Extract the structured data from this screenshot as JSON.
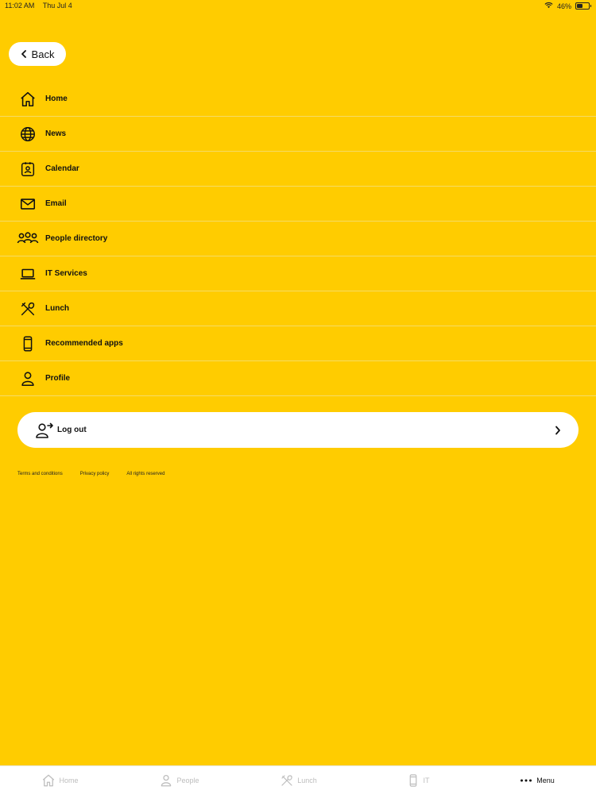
{
  "status": {
    "time": "11:02 AM",
    "date": "Thu Jul 4",
    "battery": "46%"
  },
  "back_label": "Back",
  "menu": {
    "items": [
      {
        "label": "Home",
        "icon": "home-icon"
      },
      {
        "label": "News",
        "icon": "globe-icon"
      },
      {
        "label": "Calendar",
        "icon": "calendar-icon"
      },
      {
        "label": "Email",
        "icon": "mail-icon"
      },
      {
        "label": "People directory",
        "icon": "people-icon"
      },
      {
        "label": "IT Services",
        "icon": "laptop-icon"
      },
      {
        "label": "Lunch",
        "icon": "utensils-icon"
      },
      {
        "label": "Recommended apps",
        "icon": "phone-icon"
      },
      {
        "label": "Profile",
        "icon": "user-icon"
      }
    ]
  },
  "logout": {
    "label": "Log out"
  },
  "footer": {
    "terms": "Terms and conditions",
    "privacy": "Privacy policy",
    "rights": "All rights reserved"
  },
  "tabs": [
    {
      "label": "Home",
      "icon": "home-icon"
    },
    {
      "label": "People",
      "icon": "user-icon"
    },
    {
      "label": "Lunch",
      "icon": "utensils-icon"
    },
    {
      "label": "IT",
      "icon": "phone-icon"
    },
    {
      "label": "Menu",
      "icon": "more-icon",
      "active": true
    }
  ],
  "colors": {
    "background": "#FFCC00",
    "surface": "#FFFFFF",
    "text": "#111111",
    "inactive_tab": "#BDBDBD"
  }
}
